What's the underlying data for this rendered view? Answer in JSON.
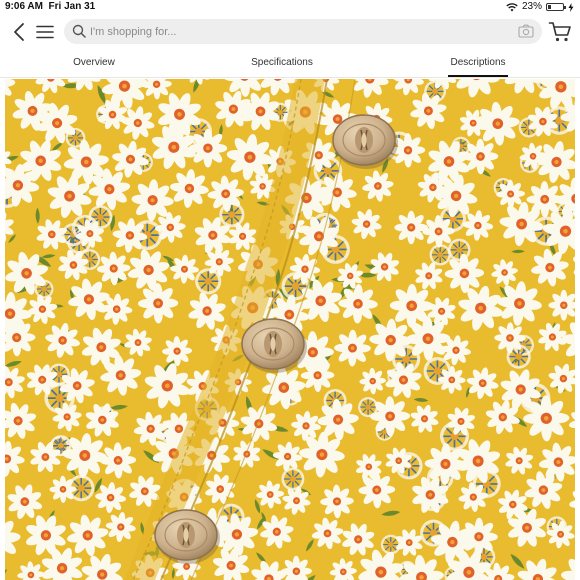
{
  "status": {
    "time": "9:06 AM",
    "date": "Fri Jan 31",
    "battery": "23%",
    "battery_level": 0.23
  },
  "search": {
    "placeholder": "I'm shopping for..."
  },
  "tabs": [
    {
      "label": "Overview"
    },
    {
      "label": "Specifications"
    },
    {
      "label": "Descriptions"
    }
  ],
  "active_tab": "Descriptions",
  "icons": {
    "back": "chevron-left-icon",
    "menu": "hamburger-menu-icon",
    "search": "search-icon",
    "camera": "camera-icon",
    "cart": "cart-icon",
    "wifi": "wifi-icon",
    "battery": "battery-icon",
    "charging": "charging-icon"
  },
  "photo": {
    "subject": "yellow daisy floral fabric with three wooden buttons",
    "colors": {
      "fabric": "#e9bb2e",
      "petal": "#fbf8ec",
      "center": "#e0622a",
      "blue_flower": "#4f6f9e",
      "leaf": "#6c8a2c",
      "button": "#cdb18c"
    }
  }
}
